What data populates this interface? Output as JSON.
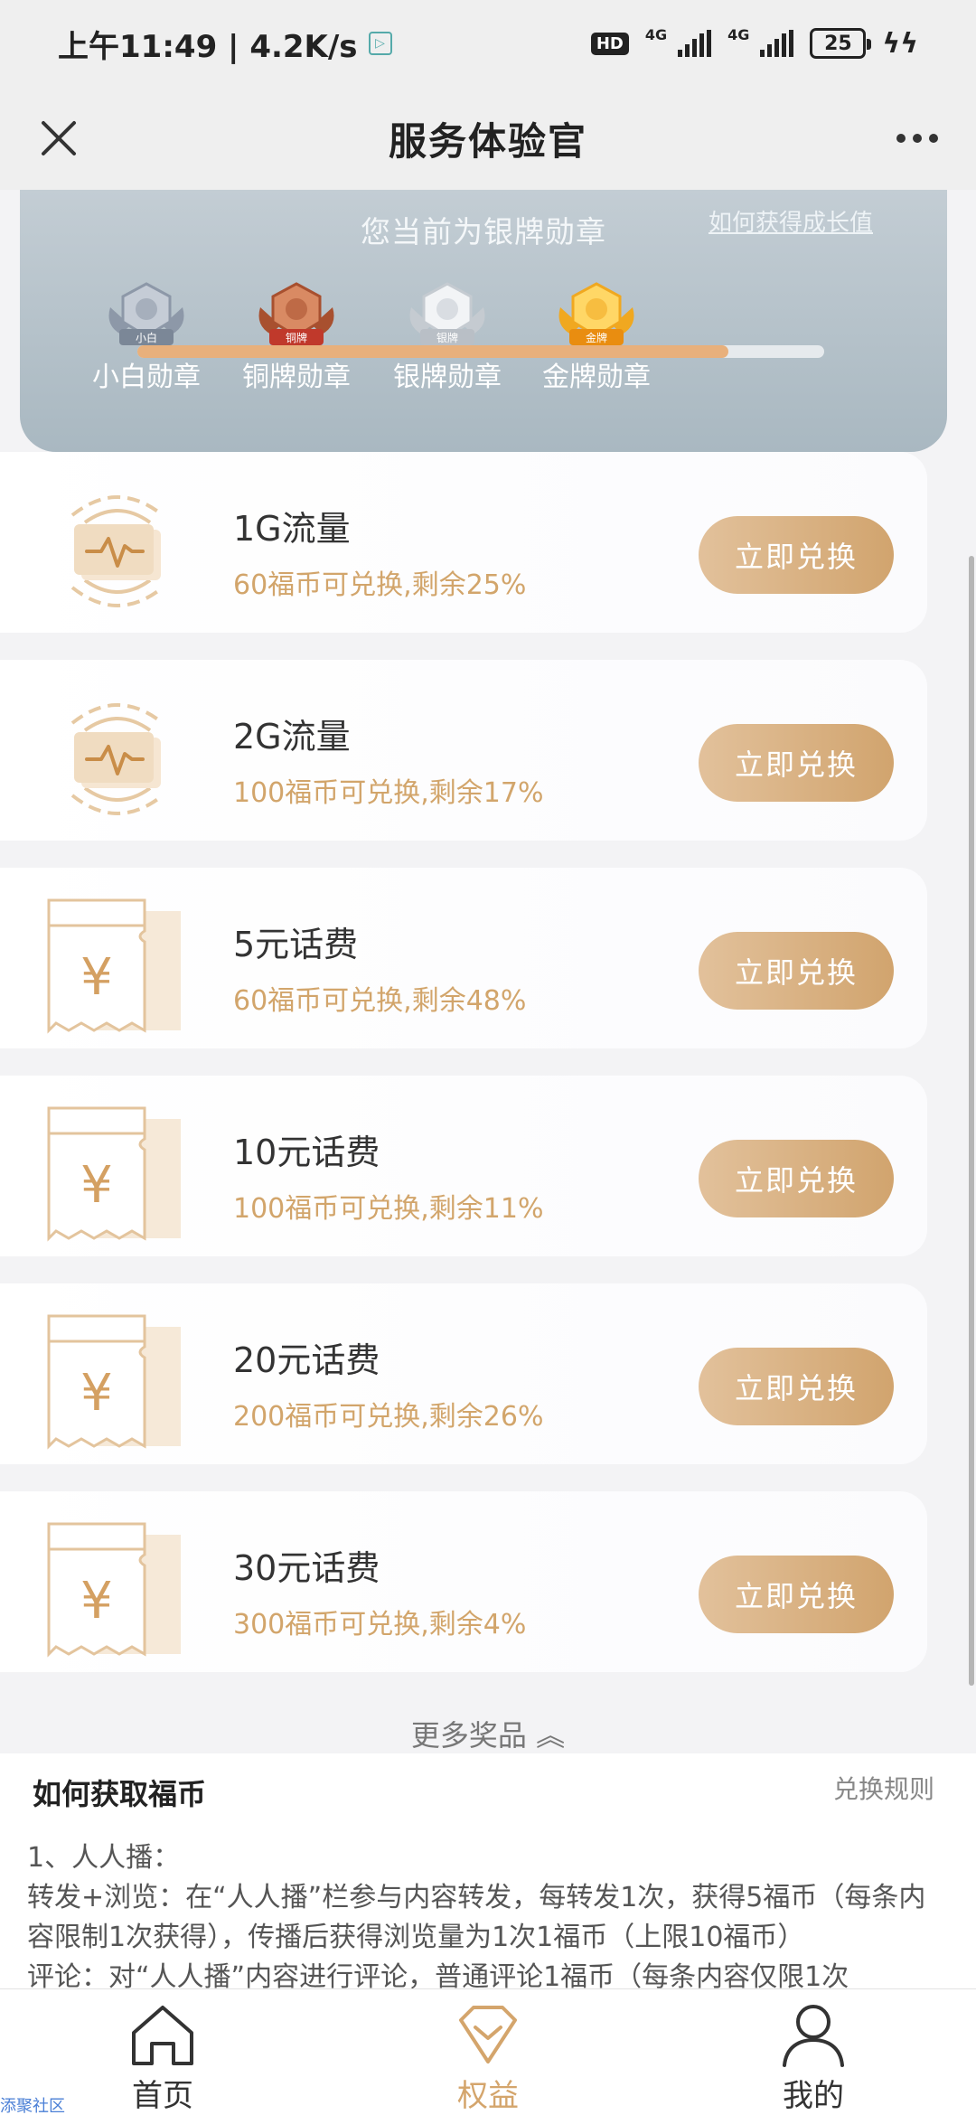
{
  "status_bar": {
    "time_speed": "上午11:49 | 4.2K/s",
    "hd": "HD",
    "net1": "4G",
    "net2": "4G",
    "battery": "25"
  },
  "header": {
    "title": "服务体验官"
  },
  "badge_panel": {
    "current_level": "您当前为银牌勋章",
    "how_to_link": "如何获得成长值",
    "progress_fraction": 0.86,
    "medals": [
      {
        "label": "小白勋章",
        "ribbon": "小白",
        "tier": "white"
      },
      {
        "label": "铜牌勋章",
        "ribbon": "铜牌",
        "tier": "bronze"
      },
      {
        "label": "银牌勋章",
        "ribbon": "银牌",
        "tier": "silver"
      },
      {
        "label": "金牌勋章",
        "ribbon": "金牌",
        "tier": "gold"
      }
    ]
  },
  "rewards": [
    {
      "name": "1G流量",
      "desc": "60福币可兑换,剩余25%",
      "icon": "data-traffic-icon",
      "button": "立即兑换"
    },
    {
      "name": "2G流量",
      "desc": "100福币可兑换,剩余17%",
      "icon": "data-traffic-icon",
      "button": "立即兑换"
    },
    {
      "name": "5元话费",
      "desc": "60福币可兑换,剩余48%",
      "icon": "phone-credit-icon",
      "button": "立即兑换"
    },
    {
      "name": "10元话费",
      "desc": "100福币可兑换,剩余11%",
      "icon": "phone-credit-icon",
      "button": "立即兑换"
    },
    {
      "name": "20元话费",
      "desc": "200福币可兑换,剩余26%",
      "icon": "phone-credit-icon",
      "button": "立即兑换"
    },
    {
      "name": "30元话费",
      "desc": "300福币可兑换,剩余4%",
      "icon": "phone-credit-icon",
      "button": "立即兑换"
    }
  ],
  "more_prizes": "更多奖品",
  "info": {
    "title": "如何获取福币",
    "rules_link": "兑换规则",
    "line1": "1、人人播：",
    "line2": "转发+浏览：在“人人播”栏参与内容转发，每转发1次，获得5福币（每条内容限制1次获得），传播后获得浏览量为1次1福币（上限10福币）",
    "line3": "评论：对“人人播”内容进行评论，普通评论1福币（每条内容仅限1次"
  },
  "nav": [
    {
      "label": "首页",
      "icon": "home-icon"
    },
    {
      "label": "权益",
      "icon": "diamond-icon"
    },
    {
      "label": "我的",
      "icon": "profile-icon"
    }
  ],
  "watermark": "添聚社区",
  "colors": {
    "gold_text": "#d2a56b",
    "button_gradient_start": "#e2c19b",
    "button_gradient_end": "#d1a46e",
    "panel": "#b3c0c8",
    "progress": "#e8b07c"
  }
}
